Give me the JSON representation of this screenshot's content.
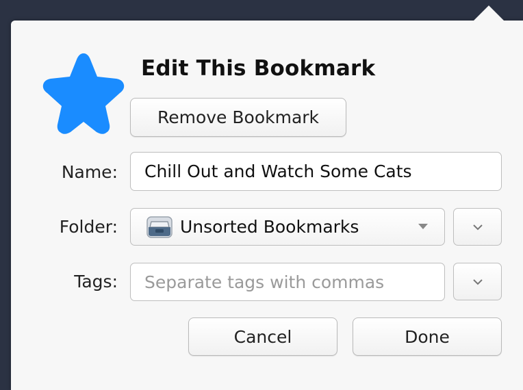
{
  "dialog": {
    "title": "Edit This Bookmark",
    "remove_label": "Remove Bookmark",
    "name_label": "Name:",
    "name_value": "Chill Out and Watch Some Cats",
    "folder_label": "Folder:",
    "folder_value": "Unsorted Bookmarks",
    "tags_label": "Tags:",
    "tags_placeholder": "Separate tags with commas",
    "cancel_label": "Cancel",
    "done_label": "Done"
  },
  "icons": {
    "star": "star-icon",
    "folder": "unsorted-bookmarks-icon",
    "select_caret": "caret-down-icon",
    "expand": "chevron-down-icon"
  },
  "colors": {
    "star": "#1a8cff",
    "background": "#2b3243",
    "panel": "#f7f7f7"
  }
}
